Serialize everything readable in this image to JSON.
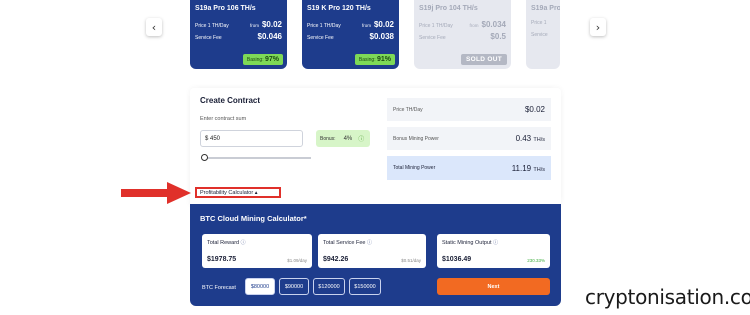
{
  "nav": {
    "prev_icon": "‹",
    "next_icon": "›"
  },
  "cards": [
    {
      "title": "S19a Pro 106 TH/s",
      "price_label": "Price 1 TH/Day",
      "price_prefix": "from",
      "price": "$0.02",
      "fee_label": "Service Fee",
      "fee": "$0.046",
      "earn_label": "Basing:",
      "earn": "97%"
    },
    {
      "title": "S19 K Pro 120 TH/s",
      "price_label": "Price 1 TH/Day",
      "price_prefix": "from",
      "price": "$0.02",
      "fee_label": "Service Fee",
      "fee": "$0.038",
      "earn_label": "Basing:",
      "earn": "91%"
    },
    {
      "title": "S19j Pro 104 TH/s",
      "price_label": "Price 1 TH/Day",
      "price_prefix": "from",
      "price": "$0.034",
      "fee_label": "Service Fee",
      "fee": "$0.5",
      "status": "SOLD OUT"
    },
    {
      "title": "S19a Pro",
      "price_label": "Price 1",
      "fee_label": "Service"
    }
  ],
  "contract": {
    "title": "Create Contract",
    "enter_label": "Enter contract sum",
    "sum_value": "$ 450",
    "bonus_label": "Bonus:",
    "bonus_value": "4%",
    "info_icon": "ⓘ",
    "slider_level": 0.02,
    "price_label": "Price TH/Day",
    "price_value": "$0.02",
    "bonus_power_label": "Bonus Mining Power",
    "bonus_power_value": "0.43",
    "bonus_power_unit": "TH/s",
    "total_power_label": "Total Mining Power",
    "total_power_value": "11.19",
    "total_power_unit": "TH/s"
  },
  "profitability_link": "Profitability Calculator ▴",
  "calculator": {
    "title": "BTC Cloud Mining Calculator*",
    "stats": [
      {
        "label": "Total Reward",
        "value": "$1978.75",
        "sub": "$1.09/day"
      },
      {
        "label": "Total Service Fee",
        "value": "$942.26",
        "sub": "$0.51/day"
      },
      {
        "label": "Static Mining Output",
        "value": "$1036.49",
        "sub": "230.33%"
      }
    ],
    "forecast_label": "BTC Forecast",
    "forecast_options": [
      "$80000",
      "$90000",
      "$120000",
      "$150000"
    ],
    "next_label": "Next"
  },
  "watermark": "cryptonisation.com",
  "colors": {
    "primary": "#1e3c8c",
    "accent": "#f26a22",
    "highlight": "#e0302a",
    "earn_badge": "#7ed957"
  }
}
